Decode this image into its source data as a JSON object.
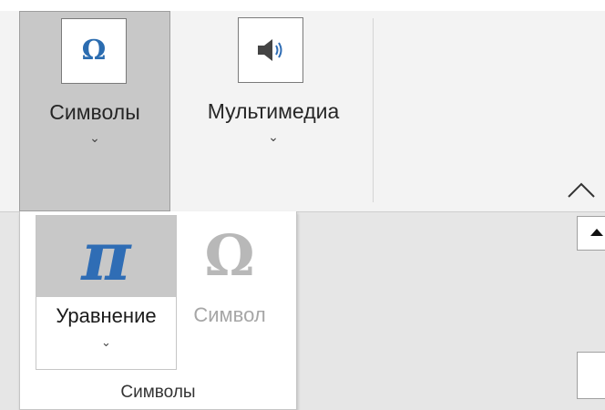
{
  "ribbon": {
    "buttons": [
      {
        "label": "Символы",
        "chevron": "⌄",
        "icon": "omega-icon",
        "icon_glyph": "Ω",
        "state": "pressed"
      },
      {
        "label": "Мультимедиа",
        "chevron": "⌄",
        "icon": "speaker-icon"
      }
    ],
    "collapse_icon": "chevron-up-icon"
  },
  "dropdown": {
    "buttons": [
      {
        "label": "Уравнение",
        "chevron": "⌄",
        "icon": "pi-icon",
        "icon_glyph": "π",
        "state": "hovered"
      },
      {
        "label": "Символ",
        "icon": "omega-icon",
        "icon_glyph": "Ω",
        "state": "disabled"
      }
    ],
    "group_label": "Символы"
  },
  "scrollbar": {
    "up_icon": "arrow-up-icon"
  },
  "colors": {
    "accent_blue": "#2f6db5",
    "pressed_bg": "#c8c8c8",
    "disabled_text": "#a6a6a6",
    "ribbon_bg": "#f3f3f3",
    "doc_bg": "#e6e6e6"
  }
}
